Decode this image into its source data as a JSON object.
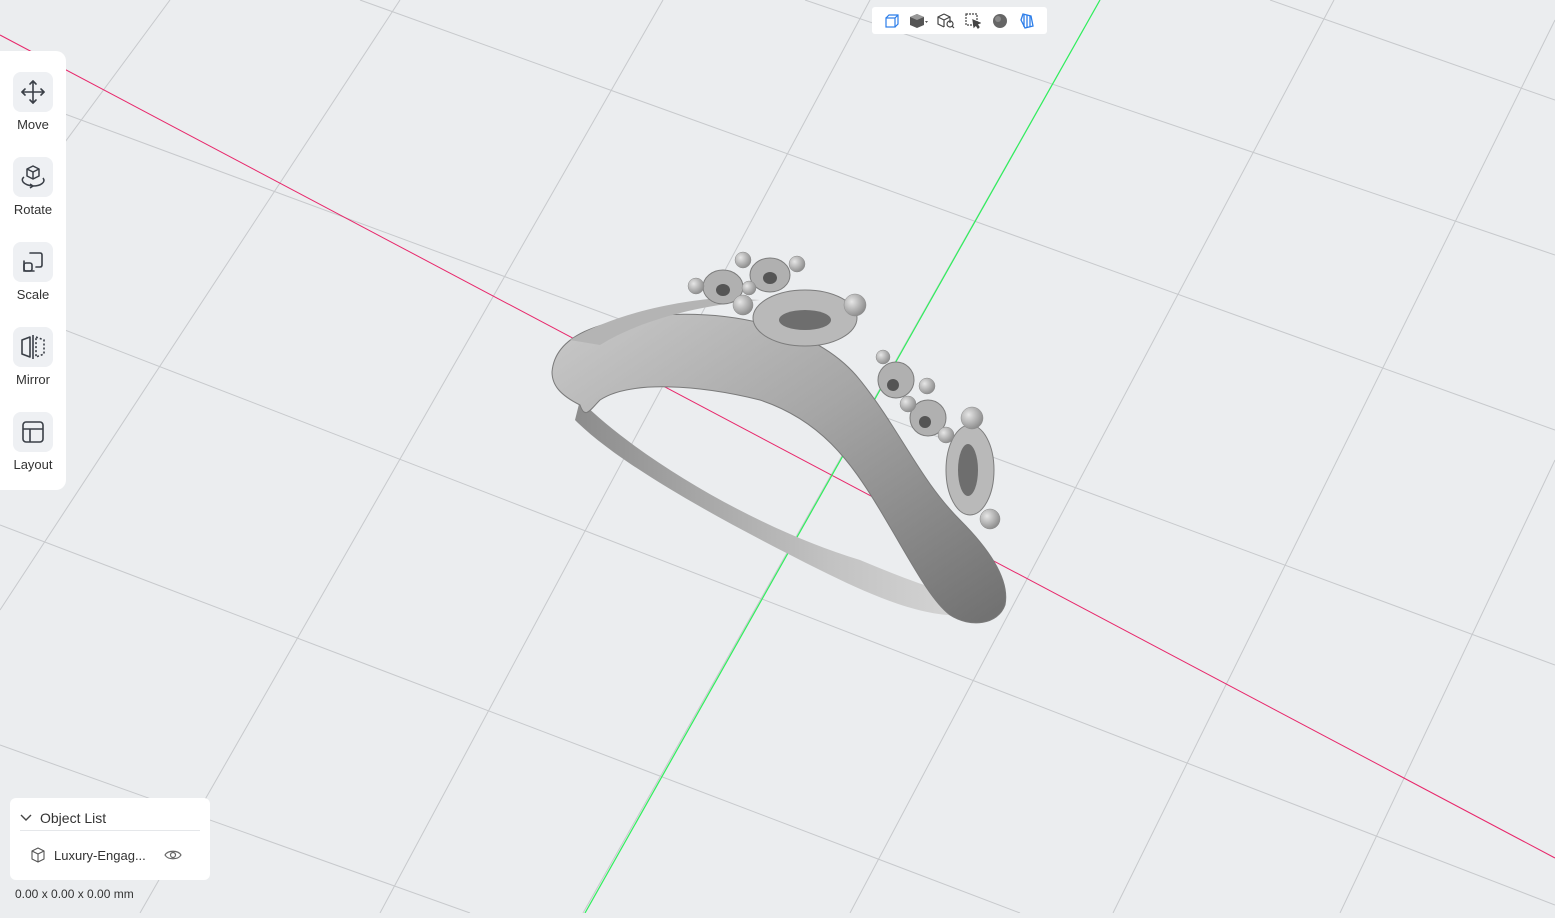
{
  "view_toolbar": {
    "buttons": [
      {
        "name": "front-view",
        "icon": "wireframe-cube-icon"
      },
      {
        "name": "view-cube-menu",
        "icon": "solid-cube-dropdown-icon"
      },
      {
        "name": "zoom-fit",
        "icon": "cube-search-icon"
      },
      {
        "name": "select-mode",
        "icon": "cursor-select-icon"
      },
      {
        "name": "shading",
        "icon": "sphere-icon"
      },
      {
        "name": "slice-view",
        "icon": "striped-shape-icon"
      }
    ],
    "active_color": "#2b7de9"
  },
  "tools": [
    {
      "label": "Move",
      "icon": "move-arrows-icon"
    },
    {
      "label": "Rotate",
      "icon": "rotate-cube-icon"
    },
    {
      "label": "Scale",
      "icon": "scale-square-icon"
    },
    {
      "label": "Mirror",
      "icon": "mirror-icon"
    },
    {
      "label": "Layout",
      "icon": "layout-grid-icon"
    }
  ],
  "object_list": {
    "title": "Object List",
    "items": [
      {
        "name": "Luxury-Engag...",
        "icon": "cube-outline-icon",
        "visible": true
      }
    ]
  },
  "dimensions": "0.00 x 0.00 x 0.00 mm",
  "colors": {
    "background": "#ebedef",
    "grid": "#c7c9cc",
    "x_axis": "#e8276b",
    "y_axis": "#2ef05c",
    "model": "#9a9a9a"
  }
}
